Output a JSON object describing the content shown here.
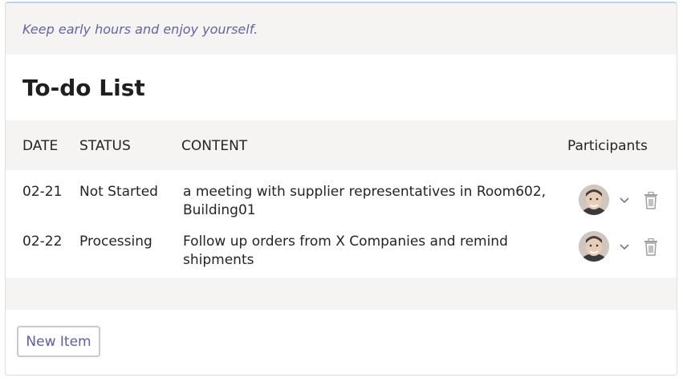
{
  "quote": "Keep early hours and enjoy yourself.",
  "title": "To-do List",
  "columns": {
    "date": "DATE",
    "status": "STATUS",
    "content": "CONTENT",
    "participants": "Participants"
  },
  "rows": [
    {
      "date": "02-21",
      "status": "Not Started",
      "content": "a meeting with supplier representatives in Room602, Building01",
      "participant_icon": "avatar-photo",
      "expand_icon": "chevron-down-icon",
      "delete_icon": "trash-icon"
    },
    {
      "date": "02-22",
      "status": "Processing",
      "content": "Follow up orders from X Companies and remind shipments",
      "participant_icon": "avatar-photo",
      "expand_icon": "chevron-down-icon",
      "delete_icon": "trash-icon"
    }
  ],
  "new_item_label": "New Item",
  "colors": {
    "accent": "#6264a7",
    "band": "#f6f4f2",
    "text": "#252423",
    "icon": "#a19f9d"
  }
}
